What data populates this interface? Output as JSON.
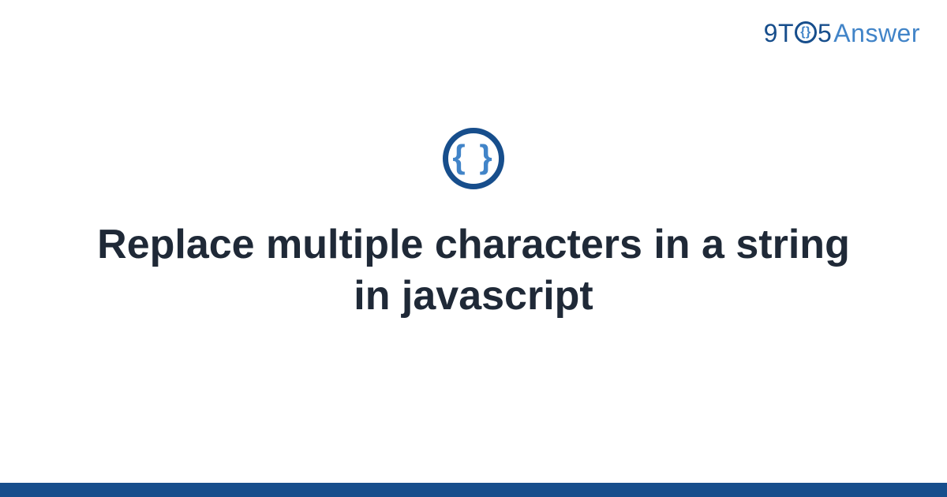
{
  "logo": {
    "part1": "9T",
    "circle_inner": "{}",
    "part2": "5",
    "part3": "Answer"
  },
  "icon": {
    "glyph": "{ }",
    "name": "code-braces-icon"
  },
  "title": "Replace multiple characters in a string in javascript",
  "colors": {
    "brand_dark": "#174e8c",
    "brand_light": "#4184c8",
    "text": "#1f2937"
  }
}
